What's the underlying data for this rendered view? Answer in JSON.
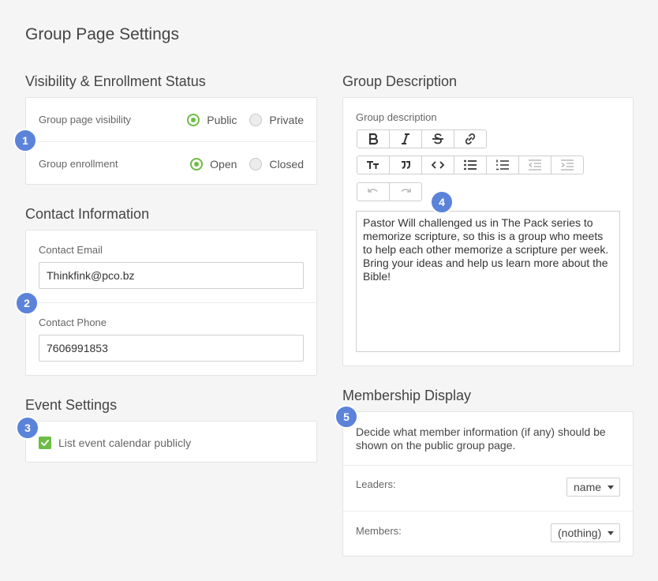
{
  "page": {
    "title": "Group Page Settings"
  },
  "visibility": {
    "title": "Visibility & Enrollment Status",
    "page_visibility": {
      "label": "Group page visibility",
      "options": [
        "Public",
        "Private"
      ],
      "selected": "Public"
    },
    "enrollment": {
      "label": "Group enrollment",
      "options": [
        "Open",
        "Closed"
      ],
      "selected": "Open"
    }
  },
  "contact": {
    "title": "Contact Information",
    "email": {
      "label": "Contact Email",
      "value": "Thinkfink@pco.bz"
    },
    "phone": {
      "label": "Contact Phone",
      "value": "7606991853"
    }
  },
  "events": {
    "title": "Event Settings",
    "list_publicly": {
      "label": "List event calendar publicly",
      "checked": true
    }
  },
  "description": {
    "title": "Group Description",
    "field_label": "Group description",
    "text": "Pastor Will challenged us in The Pack series to memorize scripture, so this is a group who meets to help each other memorize a scripture per week. Bring your ideas and help us learn more about the Bible!"
  },
  "membership": {
    "title": "Membership Display",
    "help": "Decide what member information (if any) should be shown on the public group page.",
    "leaders": {
      "label": "Leaders:",
      "value": "name"
    },
    "members": {
      "label": "Members:",
      "value": "(nothing)"
    }
  },
  "badges": [
    "1",
    "2",
    "3",
    "4",
    "5"
  ],
  "colors": {
    "accent_green": "#6cbd45",
    "badge_blue": "#5b83d9"
  }
}
